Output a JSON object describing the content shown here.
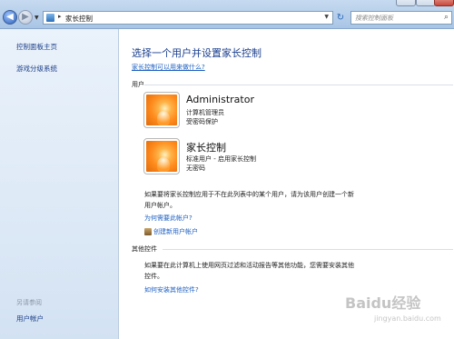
{
  "window": {
    "breadcrumb": "家长控制",
    "search_placeholder": "搜索控制面板"
  },
  "sidebar": {
    "items": [
      "控制面板主页",
      "游戏分级系统"
    ],
    "see_also_title": "另请参阅",
    "see_also_items": [
      "用户帐户"
    ]
  },
  "main": {
    "title": "选择一个用户并设置家长控制",
    "help_link": "家长控制可以用来做什么?",
    "users_section": "用户",
    "users": [
      {
        "name": "Administrator",
        "line1": "计算机管理员",
        "line2": "受密码保护"
      },
      {
        "name": "家长控制",
        "line1": "标准用户 - 启用家长控制",
        "line2": "无密码"
      }
    ],
    "create_note_line1": "如果要将家长控制应用于不在此列表中的某个用户，请为该用户创建一个新",
    "create_note_line2": "用户帐户。",
    "why_link": "为何需要此帐户?",
    "create_link": "创建新用户帐户",
    "other_section": "其他控件",
    "other_note_line1": "如果要在此计算机上使用网页过滤和活动报告等其他功能，您需要安装其他",
    "other_note_line2": "控件。",
    "install_link": "如何安装其他控件?"
  },
  "watermark": {
    "logo": "Baidu经验",
    "url": "jingyan.baidu.com"
  }
}
